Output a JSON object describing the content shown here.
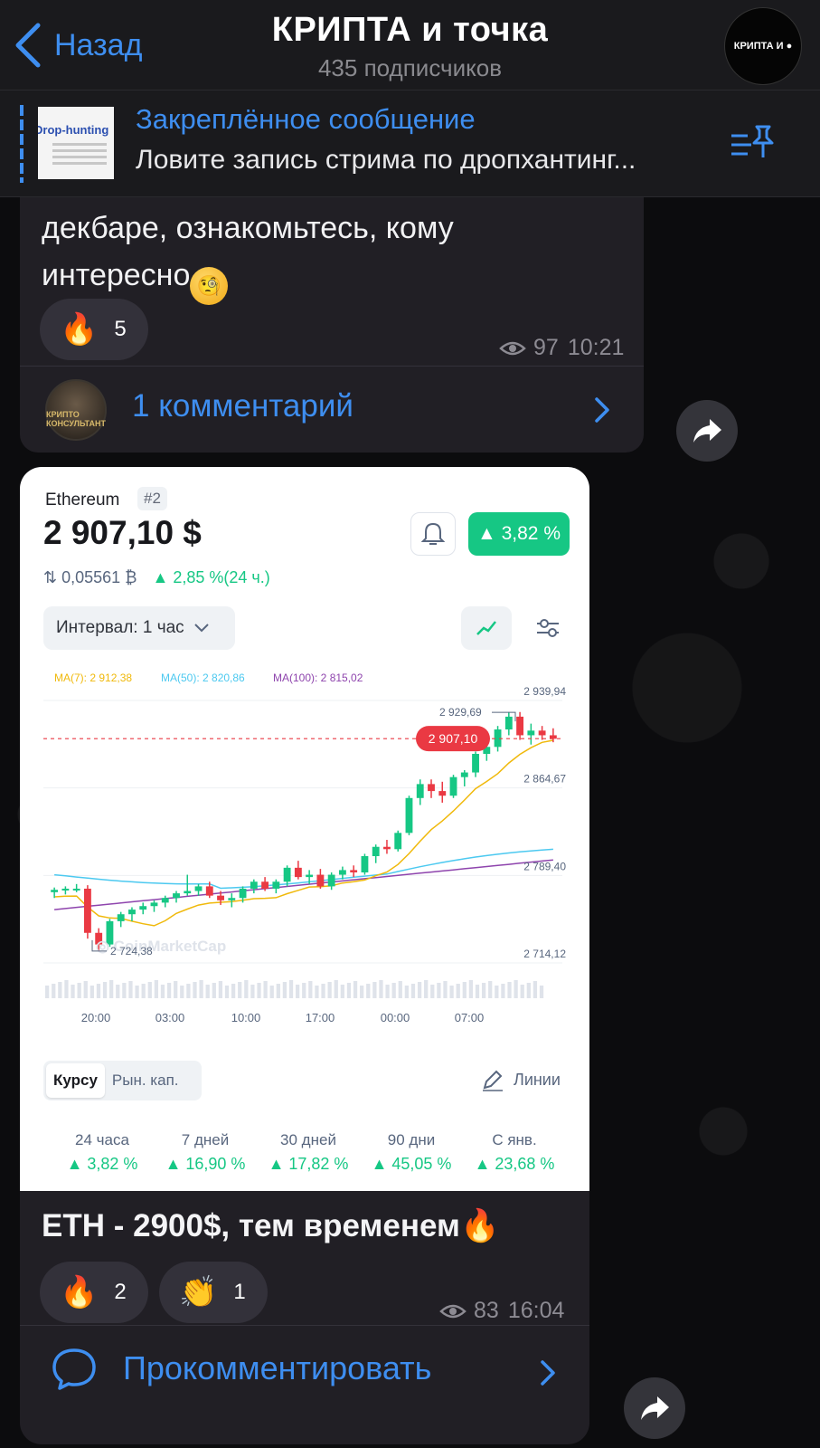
{
  "header": {
    "back_label": "Назад",
    "title": "КРИПТА и точка",
    "subscribers": "435 подписчиков",
    "avatar_text": "КРИПТА И ●"
  },
  "pinned": {
    "label": "Закреплённое сообщение",
    "text": "Ловите запись стрима по дропхантинг...",
    "thumb_text": "Drop-hunting"
  },
  "post1": {
    "text": "декбаре, ознакомьтесь, кому интересно",
    "emoji": "🧐",
    "reaction": {
      "emoji": "🔥",
      "count": "5"
    },
    "views": "97",
    "time": "10:21",
    "comments": "1 комментарий",
    "avatar_text": "КРИПТО КОНСУЛЬТАНТ"
  },
  "post2": {
    "card": {
      "coin": "Ethereum",
      "rank": "#2",
      "price": "2 907,10 $",
      "change_badge": "▲ 3,82 %",
      "btc_value": "0,05561 ₿",
      "change_24h": "▲ 2,85 %(24 ч.)",
      "interval": "Интервал: 1 час",
      "watermark": "CoinMarketCap",
      "tab_price": "Курсу",
      "tab_cap": "Рын. кап.",
      "lines": "Линии",
      "periods": [
        {
          "label": "24 часа",
          "value": "▲ 3,82 %"
        },
        {
          "label": "7 дней",
          "value": "▲ 16,90 %"
        },
        {
          "label": "30 дней",
          "value": "▲ 17,82 %"
        },
        {
          "label": "90 дни",
          "value": "▲ 45,05 %"
        },
        {
          "label": "С янв.",
          "value": "▲ 23,68 %"
        }
      ]
    },
    "text": "ETH - 2900$, тем временем",
    "text_emoji": "🔥",
    "reactions": [
      {
        "emoji": "🔥",
        "count": "2"
      },
      {
        "emoji": "👏",
        "count": "1"
      }
    ],
    "views": "83",
    "time": "16:04",
    "comment_cta": "Прокомментировать"
  },
  "colors": {
    "accent": "#3e8ef0",
    "green": "#16c784",
    "red": "#ea3943"
  },
  "chart_data": {
    "type": "candlestick",
    "legend": [
      "MA(7): 2 912,38",
      "MA(50): 2 820,86",
      "MA(100): 2 815,02"
    ],
    "y_ticks": [
      "2 939,94",
      "2 864,67",
      "2 789,40",
      "2 714,12"
    ],
    "x_ticks": [
      "20:00",
      "03:00",
      "10:00",
      "17:00",
      "00:00",
      "07:00"
    ],
    "ylim": [
      2714.12,
      2939.94
    ],
    "current_price": 2907.1,
    "current_label": "2 907,10",
    "high_label": "2 929,69",
    "high": 2929.69,
    "low_label": "2 724,38",
    "low": 2724.38,
    "candles": [
      [
        2775,
        2779,
        2770,
        2777
      ],
      [
        2777,
        2780,
        2773,
        2778
      ],
      [
        2778,
        2782,
        2775,
        2778
      ],
      [
        2778,
        2781,
        2735,
        2740
      ],
      [
        2740,
        2744,
        2724,
        2730
      ],
      [
        2730,
        2752,
        2728,
        2750
      ],
      [
        2750,
        2758,
        2745,
        2756
      ],
      [
        2756,
        2762,
        2750,
        2760
      ],
      [
        2760,
        2766,
        2756,
        2763
      ],
      [
        2763,
        2768,
        2758,
        2766
      ],
      [
        2766,
        2772,
        2762,
        2770
      ],
      [
        2770,
        2776,
        2766,
        2774
      ],
      [
        2774,
        2790,
        2772,
        2776
      ],
      [
        2776,
        2782,
        2772,
        2780
      ],
      [
        2780,
        2784,
        2770,
        2772
      ],
      [
        2772,
        2776,
        2764,
        2768
      ],
      [
        2768,
        2774,
        2762,
        2770
      ],
      [
        2770,
        2780,
        2766,
        2778
      ],
      [
        2778,
        2786,
        2774,
        2784
      ],
      [
        2784,
        2788,
        2776,
        2778
      ],
      [
        2778,
        2786,
        2774,
        2784
      ],
      [
        2784,
        2798,
        2780,
        2796
      ],
      [
        2796,
        2802,
        2786,
        2788
      ],
      [
        2788,
        2794,
        2782,
        2790
      ],
      [
        2790,
        2795,
        2778,
        2780
      ],
      [
        2780,
        2792,
        2777,
        2790
      ],
      [
        2790,
        2797,
        2786,
        2794
      ],
      [
        2794,
        2798,
        2788,
        2792
      ],
      [
        2792,
        2808,
        2790,
        2806
      ],
      [
        2806,
        2816,
        2800,
        2814
      ],
      [
        2814,
        2820,
        2808,
        2812
      ],
      [
        2812,
        2828,
        2810,
        2826
      ],
      [
        2826,
        2858,
        2824,
        2856
      ],
      [
        2856,
        2872,
        2850,
        2868
      ],
      [
        2868,
        2872,
        2856,
        2862
      ],
      [
        2862,
        2870,
        2852,
        2858
      ],
      [
        2858,
        2876,
        2856,
        2874
      ],
      [
        2874,
        2880,
        2866,
        2878
      ],
      [
        2878,
        2896,
        2874,
        2894
      ],
      [
        2894,
        2904,
        2888,
        2900
      ],
      [
        2900,
        2918,
        2896,
        2915
      ],
      [
        2915,
        2930,
        2910,
        2926
      ],
      [
        2926,
        2930,
        2906,
        2910
      ],
      [
        2910,
        2920,
        2902,
        2914
      ],
      [
        2914,
        2918,
        2906,
        2910
      ],
      [
        2910,
        2916,
        2904,
        2907
      ]
    ]
  }
}
